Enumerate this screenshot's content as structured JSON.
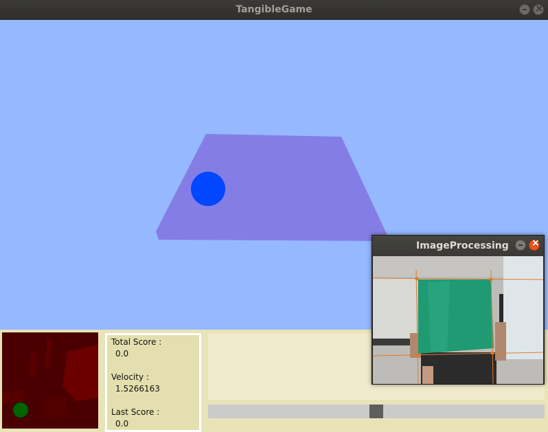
{
  "window": {
    "title": "TangibleGame"
  },
  "scene": {
    "background": "#95b8ff",
    "plate_color": "#857de6",
    "ball_color": "#0047ff"
  },
  "scoreboard": {
    "total_score_label": "Total Score :",
    "total_score_value": "0.0",
    "velocity_label": "Velocity :",
    "velocity_value": "1.5266163",
    "last_score_label": "Last Score :",
    "last_score_value": "0.0"
  },
  "topview": {
    "background": "#4a0000",
    "ball_color": "#006400"
  },
  "scrollbar": {
    "handle_fraction": 0.5
  },
  "image_processing": {
    "title": "ImageProcessing",
    "board_color": "#1f9a72",
    "line_color": "#e07a2a"
  }
}
